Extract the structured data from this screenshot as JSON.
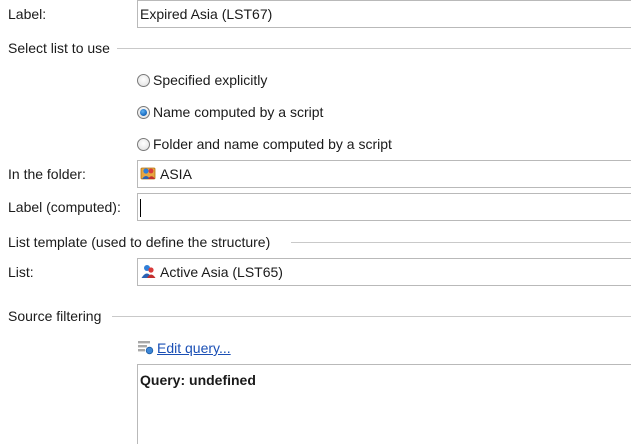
{
  "form": {
    "label_field": {
      "label": "Label:",
      "value": "Expired Asia (LST67)"
    },
    "select_list_group": {
      "title": "Select list to use",
      "options": [
        {
          "label": "Specified explicitly",
          "selected": false
        },
        {
          "label": "Name computed by a script",
          "selected": true
        },
        {
          "label": "Folder and name computed by a script",
          "selected": false
        }
      ]
    },
    "folder_field": {
      "label": "In the folder:",
      "value": "ASIA",
      "icon": "folder-people-icon"
    },
    "computed_label_field": {
      "label": "Label (computed):",
      "value": ""
    },
    "list_template_group": {
      "title": "List template (used to define the structure)"
    },
    "list_field": {
      "label": "List:",
      "value": "Active Asia (LST65)",
      "icon": "list-people-icon"
    },
    "source_filtering_group": {
      "title": "Source filtering",
      "edit_query_label": "Edit query...",
      "edit_query_icon": "query-filter-icon",
      "query_text": "Query: undefined"
    }
  },
  "colors": {
    "link": "#1a4fb5",
    "radio_selected": "#1d6fc4",
    "border": "#b9b9b9",
    "group_line": "#c9c9c9"
  }
}
